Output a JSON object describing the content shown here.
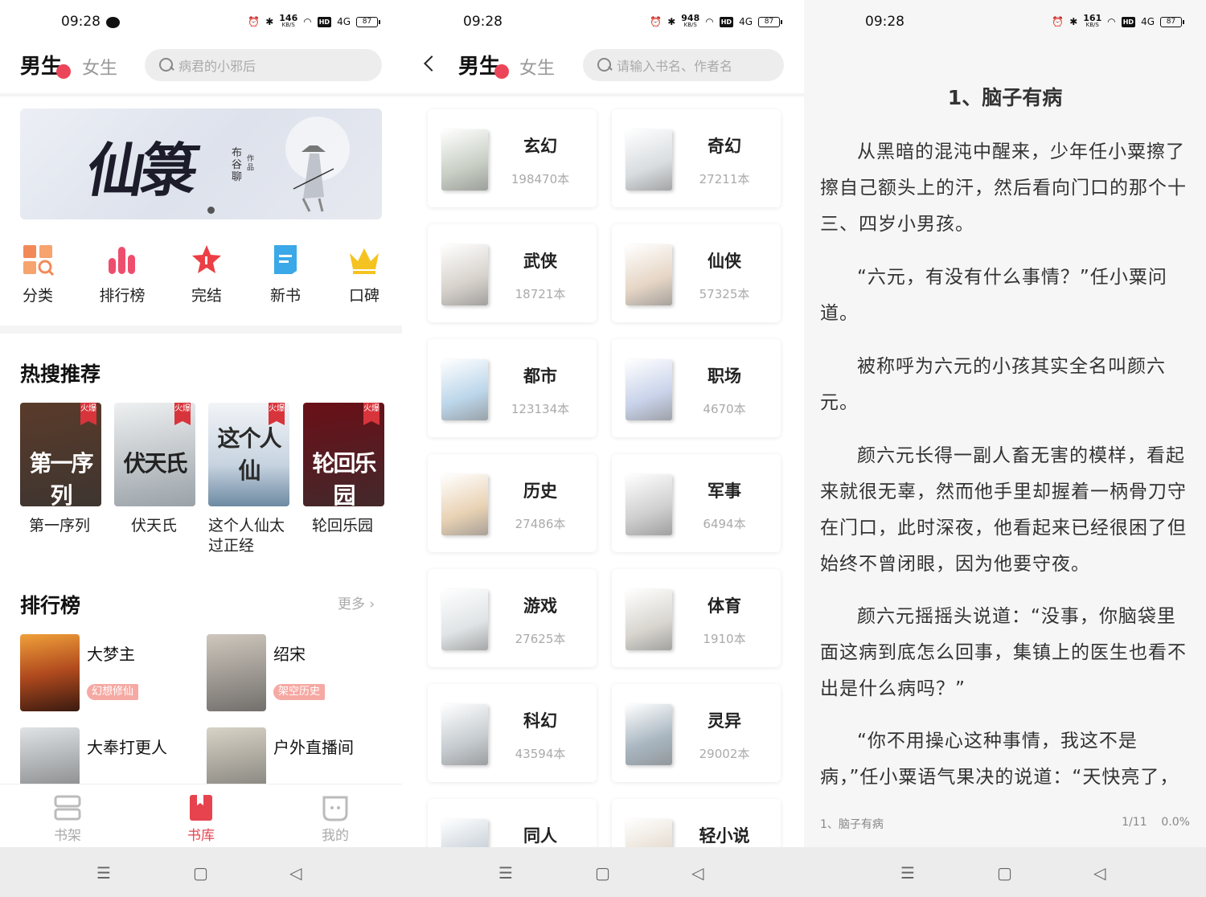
{
  "status": {
    "time": "09:28",
    "speeds": [
      "146",
      "948",
      "161"
    ],
    "speed_unit": "KB/S",
    "hd": "HD",
    "signal": "4G",
    "battery": "87"
  },
  "library": {
    "gender_active": "男生",
    "gender_inactive": "女生",
    "search_placeholder": "病君的小邪后",
    "banner": {
      "title": "仙箓",
      "author": "布谷聊",
      "author_suffix": "作品"
    },
    "quick": [
      {
        "label": "分类",
        "icon": "category-icon"
      },
      {
        "label": "排行榜",
        "icon": "ranking-icon"
      },
      {
        "label": "完结",
        "icon": "star-icon"
      },
      {
        "label": "新书",
        "icon": "new-book-icon"
      },
      {
        "label": "口碑",
        "icon": "crown-icon"
      }
    ],
    "hot_title": "热搜推荐",
    "hot_badge": "火爆",
    "hot": [
      {
        "name": "第一序列",
        "cover_text": "第一序列",
        "color": "#5a3b2a"
      },
      {
        "name": "伏天氏",
        "cover_text": "伏天氏",
        "color": "#9aa2a8"
      },
      {
        "name": "这个人仙太过正经",
        "cover_text": "这个人仙",
        "color": "#c7d3e0"
      },
      {
        "name": "轮回乐园",
        "cover_text": "轮回乐园",
        "color": "#6a0f17"
      }
    ],
    "rank_title": "排行榜",
    "more": "更多",
    "ranks": [
      {
        "name": "大梦主",
        "tag": "幻想修仙",
        "color": "#b04a1e"
      },
      {
        "name": "绍宋",
        "tag": "架空历史",
        "color": "#cfc7bd"
      },
      {
        "name": "大奉打更人",
        "tag": "",
        "color": "#dfe3e6"
      },
      {
        "name": "户外直播间",
        "tag": "",
        "color": "#d8d3c6"
      }
    ],
    "tabs": [
      {
        "label": "书架",
        "icon": "bookshelf-icon"
      },
      {
        "label": "书库",
        "icon": "library-icon"
      },
      {
        "label": "我的",
        "icon": "profile-icon"
      }
    ]
  },
  "categories": {
    "gender_active": "男生",
    "gender_inactive": "女生",
    "search_placeholder": "请输入书名、作者名",
    "items": [
      {
        "name": "玄幻",
        "count": "198470本",
        "color": "#c8cfc4"
      },
      {
        "name": "奇幻",
        "count": "27211本",
        "color": "#d9dde0"
      },
      {
        "name": "武侠",
        "count": "18721本",
        "color": "#d7d2cc"
      },
      {
        "name": "仙侠",
        "count": "57325本",
        "color": "#e6d6c6"
      },
      {
        "name": "都市",
        "count": "123134本",
        "color": "#bcd6ea"
      },
      {
        "name": "职场",
        "count": "4670本",
        "color": "#c9d3ea"
      },
      {
        "name": "历史",
        "count": "27486本",
        "color": "#e9d2b4"
      },
      {
        "name": "军事",
        "count": "6494本",
        "color": "#cfcfcf"
      },
      {
        "name": "游戏",
        "count": "27625本",
        "color": "#e0e4e6"
      },
      {
        "name": "体育",
        "count": "1910本",
        "color": "#d9d6d0"
      },
      {
        "name": "科幻",
        "count": "43594本",
        "color": "#c6ccd0"
      },
      {
        "name": "灵异",
        "count": "29002本",
        "color": "#a8b6c0"
      },
      {
        "name": "同人",
        "count": "",
        "color": "#c9d2da"
      },
      {
        "name": "轻小说",
        "count": "",
        "color": "#e6dcd0"
      }
    ]
  },
  "reader": {
    "chapter_title": "1、脑子有病",
    "paragraphs": [
      "从黑暗的混沌中醒来，少年任小粟擦了擦自己额头上的汗，然后看向门口的那个十三、四岁小男孩。",
      "“六元，有没有什么事情？”任小粟问道。",
      "被称呼为六元的小孩其实全名叫颜六元。",
      "颜六元长得一副人畜无害的模样，看起来就很无辜，然而他手里却握着一柄骨刀守在门口，此时深夜，他看起来已经很困了但始终不曾闭眼，因为他要守夜。",
      "颜六元摇摇头说道：“没事，你脑袋里面这病到底怎么回事，集镇上的医生也看不出是什么病吗？”",
      "“你不用操心这种事情，我这不是病，”任小粟语气果决的说道：“天快亮了，我准备"
    ],
    "footer_chapter": "1、脑子有病",
    "page": "1/11",
    "progress": "0.0%"
  }
}
